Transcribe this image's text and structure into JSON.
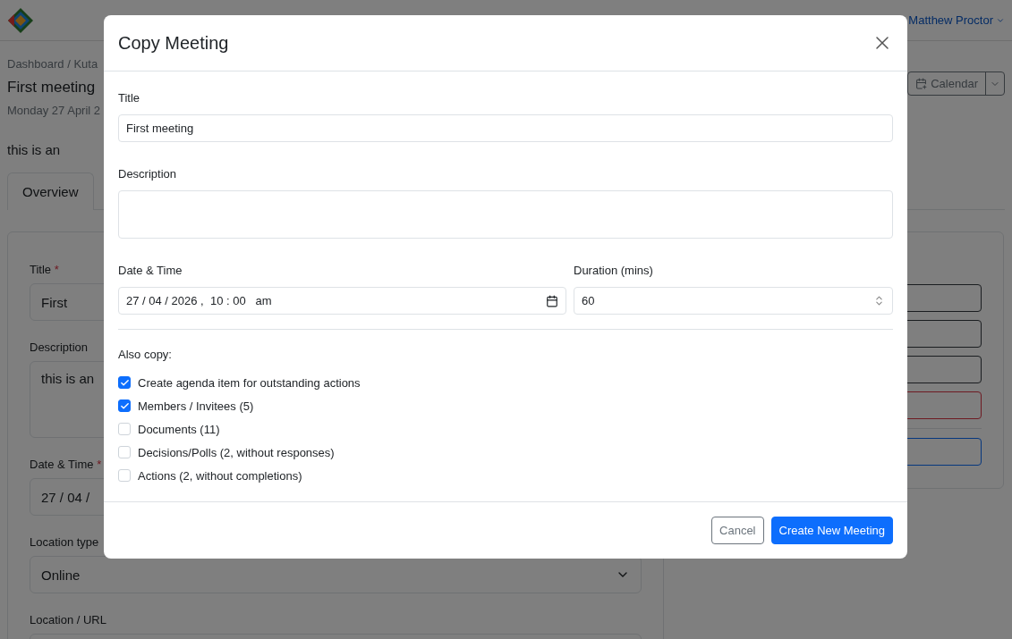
{
  "navbar": {
    "user": "Matthew Proctor"
  },
  "page": {
    "breadcrumb": "Dashboard  /  Kuta",
    "title": "First meeting",
    "date": "Monday 27 April 2",
    "description": "this is an",
    "calendar_button": "Calendar",
    "tabs": [
      {
        "label": "Overview",
        "selected": true
      }
    ],
    "form": [
      {
        "kind": "input",
        "label": "Title",
        "required_mark": "*",
        "value": "First"
      },
      {
        "kind": "textarea",
        "label": "Description",
        "value": "this is an"
      },
      {
        "kind": "input",
        "label": "Date & Time",
        "required_mark": "*",
        "value": "27 / 04 /"
      },
      {
        "kind": "select",
        "label": "Location type",
        "value": "Online"
      },
      {
        "kind": "input",
        "label": "Location / URL"
      }
    ],
    "side_buttons": [
      {
        "kind": "dark"
      },
      {
        "kind": "dark"
      },
      {
        "kind": "dark"
      },
      {
        "kind": "danger"
      },
      {
        "kind": "primary"
      }
    ]
  },
  "modal": {
    "title": "Copy Meeting",
    "title_label": "Title",
    "title_value": "First meeting",
    "description_label": "Description",
    "datetime_label": "Date & Time",
    "datetime_value": "27 / 04 / 2026 ,  10 : 00   am",
    "duration_label": "Duration (mins)",
    "duration_value": "60",
    "also_copy": "Also copy:",
    "options": [
      {
        "label": "Create agenda item for outstanding actions",
        "checked": true
      },
      {
        "label": "Members / Invitees (5)",
        "checked": true
      },
      {
        "label": "Documents (11)",
        "checked": false
      },
      {
        "label": "Decisions/Polls (2, without responses)",
        "checked": false
      },
      {
        "label": "Actions (2, without completions)",
        "checked": false
      }
    ],
    "buttons": {
      "cancel": "Cancel",
      "create": "Create New Meeting"
    }
  }
}
